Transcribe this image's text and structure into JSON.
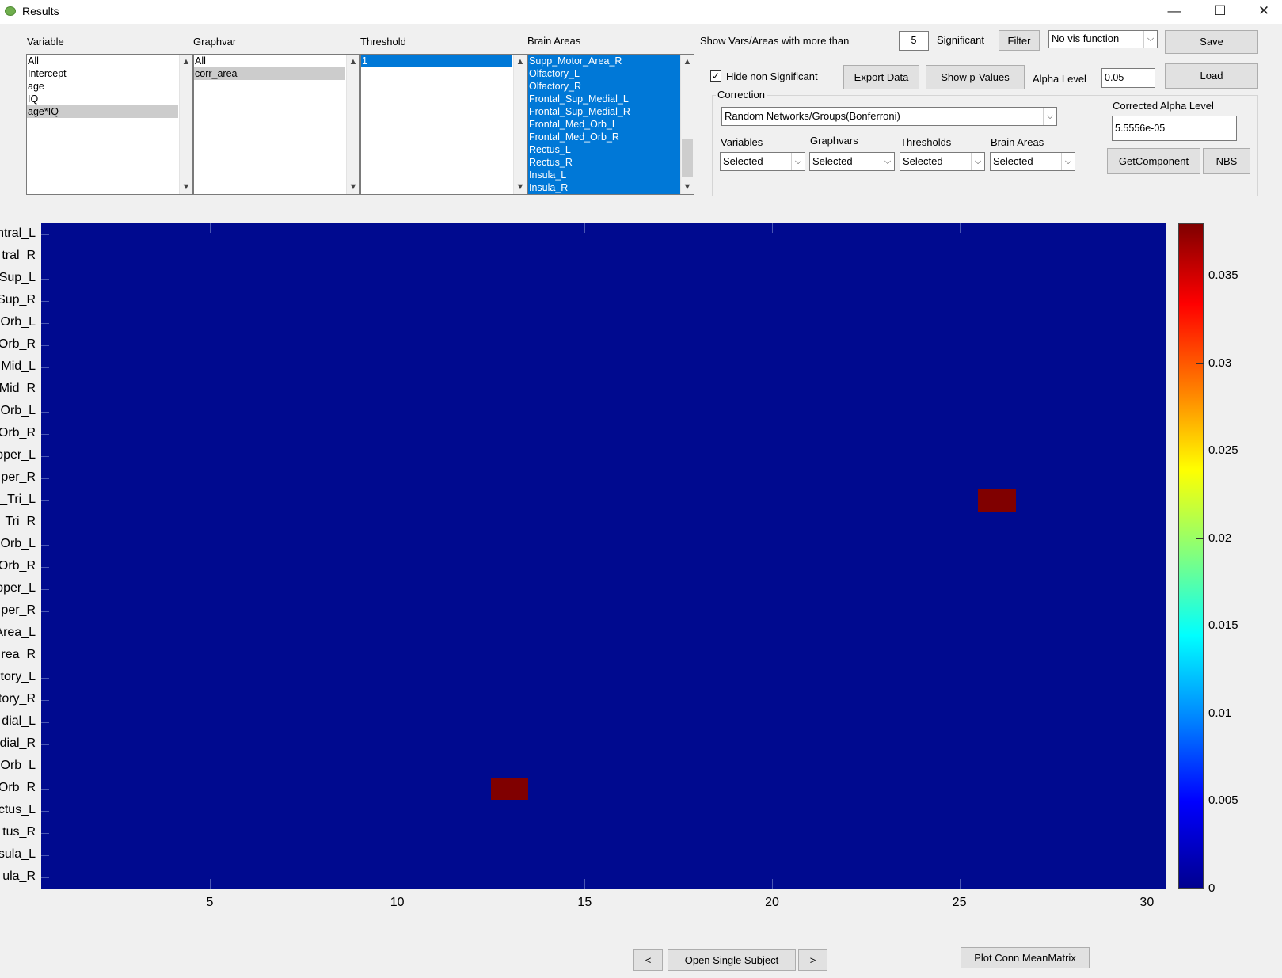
{
  "window": {
    "title": "Results",
    "minimize": "—",
    "maximize": "☐",
    "close": "✕"
  },
  "selectors": {
    "variable": {
      "label": "Variable",
      "items": [
        "All",
        "Intercept",
        "age",
        "IQ",
        "age*IQ"
      ],
      "selected": "age*IQ"
    },
    "graphvar": {
      "label": "Graphvar",
      "items": [
        "All",
        "corr_area"
      ],
      "selected": "corr_area"
    },
    "threshold": {
      "label": "Threshold",
      "items": [
        "1"
      ],
      "selected": "1"
    },
    "brain_areas": {
      "label": "Brain Areas",
      "items": [
        "Supp_Motor_Area_R",
        "Olfactory_L",
        "Olfactory_R",
        "Frontal_Sup_Medial_L",
        "Frontal_Sup_Medial_R",
        "Frontal_Med_Orb_L",
        "Frontal_Med_Orb_R",
        "Rectus_L",
        "Rectus_R",
        "Insula_L",
        "Insula_R"
      ]
    }
  },
  "filter": {
    "show_label": "Show Vars/Areas with more than",
    "count": "5",
    "significant_label": "Significant",
    "filter_button": "Filter",
    "vis_function": "No vis function",
    "hide_non_significant": "Hide non Significant",
    "hide_checked": "✓"
  },
  "actions": {
    "save": "Save",
    "load": "Load",
    "export_data": "Export Data",
    "show_p_values": "Show p-Values",
    "alpha_label": "Alpha Level",
    "alpha_value": "0.05"
  },
  "correction": {
    "label": "Correction",
    "method": "Random Networks/Groups(Bonferroni)",
    "corrected_alpha_label": "Corrected Alpha Level",
    "corrected_alpha_value": "5.5556e-05",
    "variables_label": "Variables",
    "variables_value": "Selected",
    "graphvars_label": "Graphvars",
    "graphvars_value": "Selected",
    "thresholds_label": "Thresholds",
    "thresholds_value": "Selected",
    "brain_areas_label": "Brain Areas",
    "brain_areas_value": "Selected",
    "get_component": "GetComponent",
    "nbs": "NBS"
  },
  "icons": {
    "scroll_up": "▲",
    "scroll_down": "▼",
    "dropdown": "⌵"
  },
  "chart_data": {
    "type": "heatmap",
    "ytick_labels": [
      "ntral_L",
      "tral_R",
      "Sup_L",
      "Sup_R",
      "Orb_L",
      "Orb_R",
      "Mid_L",
      "Mid_R",
      "Orb_L",
      "Orb_R",
      "oper_L",
      "per_R",
      "_Tri_L",
      "_Tri_R",
      "Orb_L",
      "Orb_R",
      "oper_L",
      "per_R",
      "Area_L",
      "rea_R",
      "tory_L",
      "tory_R",
      "dial_L",
      "dial_R",
      "Orb_L",
      "Orb_R",
      "ctus_L",
      "tus_R",
      "sula_L",
      "ula_R"
    ],
    "xticks": [
      5,
      10,
      15,
      20,
      25,
      30
    ],
    "xlim": [
      0.5,
      30.5
    ],
    "rows": 30,
    "cells": [
      {
        "x": 26,
        "y": 13,
        "value": 0.038
      },
      {
        "x": 13,
        "y": 26,
        "value": 0.038
      }
    ],
    "background_value": 0,
    "colorbar": {
      "ticks": [
        0,
        0.005,
        0.01,
        0.015,
        0.02,
        0.025,
        0.03,
        0.035
      ],
      "tick_labels": [
        "0",
        "0.005",
        "0.01",
        "0.015",
        "0.02",
        "0.025",
        "0.03",
        "0.035"
      ],
      "range": [
        0,
        0.038
      ]
    }
  },
  "navigation": {
    "prev": "<",
    "open_single_subject": "Open Single Subject",
    "next": ">",
    "plot_conn_mean_matrix": "Plot Conn MeanMatrix"
  }
}
